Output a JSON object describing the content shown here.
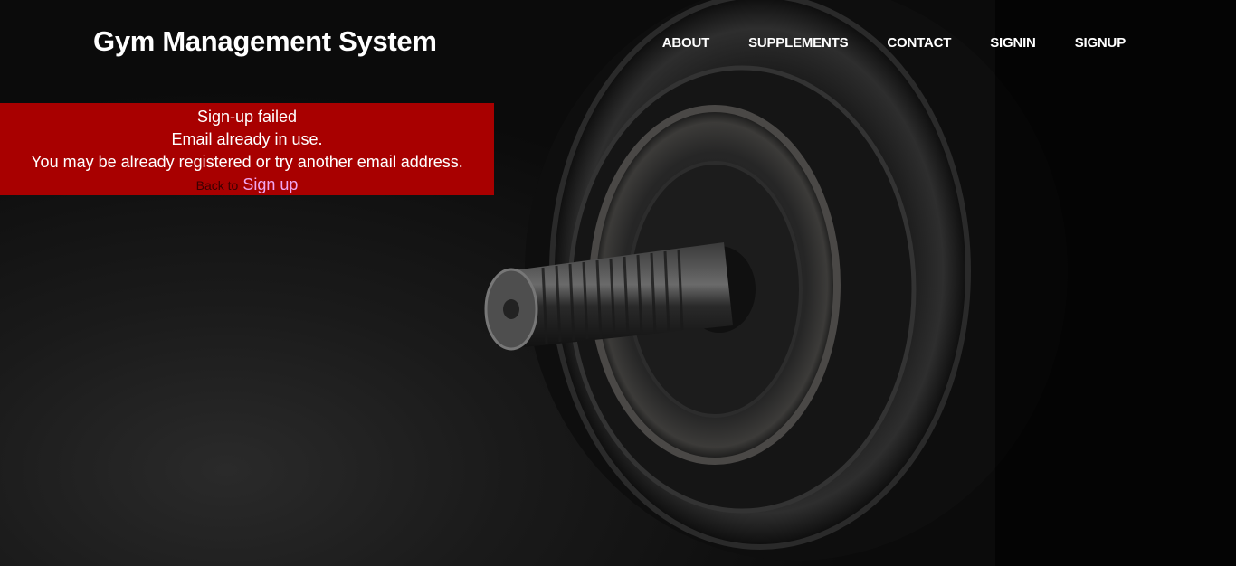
{
  "header": {
    "brand": "Gym Management System",
    "nav": [
      {
        "label": "ABOUT"
      },
      {
        "label": "SUPPLEMENTS"
      },
      {
        "label": "CONTACT"
      },
      {
        "label": "SIGNIN"
      },
      {
        "label": "SIGNUP"
      }
    ]
  },
  "alert": {
    "title": "Sign-up failed",
    "message": "Email already in use.",
    "hint": "You may be already registered or try another email address.",
    "back_prefix": "Back to",
    "back_link": "Sign up"
  },
  "colors": {
    "alert_bg": "#a80000",
    "link": "#f0a6f0"
  },
  "background_image": "dumbbell-weight-plate"
}
